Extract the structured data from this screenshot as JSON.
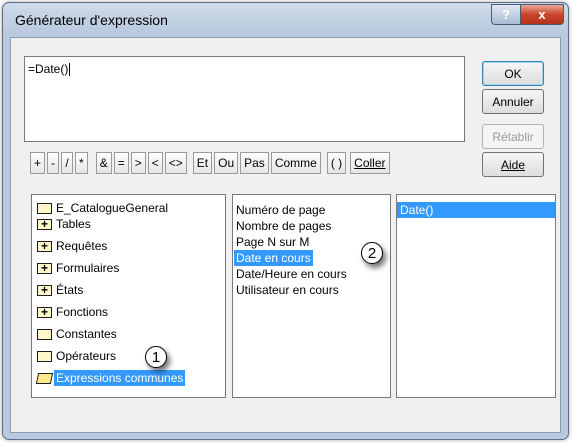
{
  "window": {
    "title": "Générateur d'expression",
    "help_label": "?",
    "close_label": "x"
  },
  "expression": {
    "value": "=Date()"
  },
  "buttons": {
    "ok": "OK",
    "cancel": "Annuler",
    "undo": "Rétablir",
    "help": "Aide",
    "paste": "Coller"
  },
  "operators": [
    "+",
    "-",
    "/",
    "*",
    "&",
    "=",
    ">",
    "<",
    "<>",
    "Et",
    "Ou",
    "Pas",
    "Comme",
    "( )"
  ],
  "objects_list": [
    {
      "label": "E_CatalogueGeneral",
      "icon": "folder-icon"
    },
    {
      "label": "Tables",
      "icon": "plus-folder-icon"
    },
    {
      "label": "Requêtes",
      "icon": "plus-folder-icon"
    },
    {
      "label": "Formulaires",
      "icon": "plus-folder-icon"
    },
    {
      "label": "États",
      "icon": "plus-folder-icon"
    },
    {
      "label": "Fonctions",
      "icon": "plus-folder-icon"
    },
    {
      "label": "Constantes",
      "icon": "folder-icon"
    },
    {
      "label": "Opérateurs",
      "icon": "folder-icon"
    },
    {
      "label": "Expressions communes",
      "icon": "open-folder-icon",
      "selected": true
    }
  ],
  "categories_list": [
    "Numéro de page",
    "Nombre de pages",
    "Page N sur M",
    "Date en cours",
    "Date/Heure en cours",
    "Utilisateur en cours"
  ],
  "categories_selected": 3,
  "values_list": [
    "Date()"
  ],
  "callouts": {
    "one": "1",
    "two": "2"
  },
  "colors": {
    "selection": "#3399ff",
    "frame": "#b9c9dd"
  }
}
